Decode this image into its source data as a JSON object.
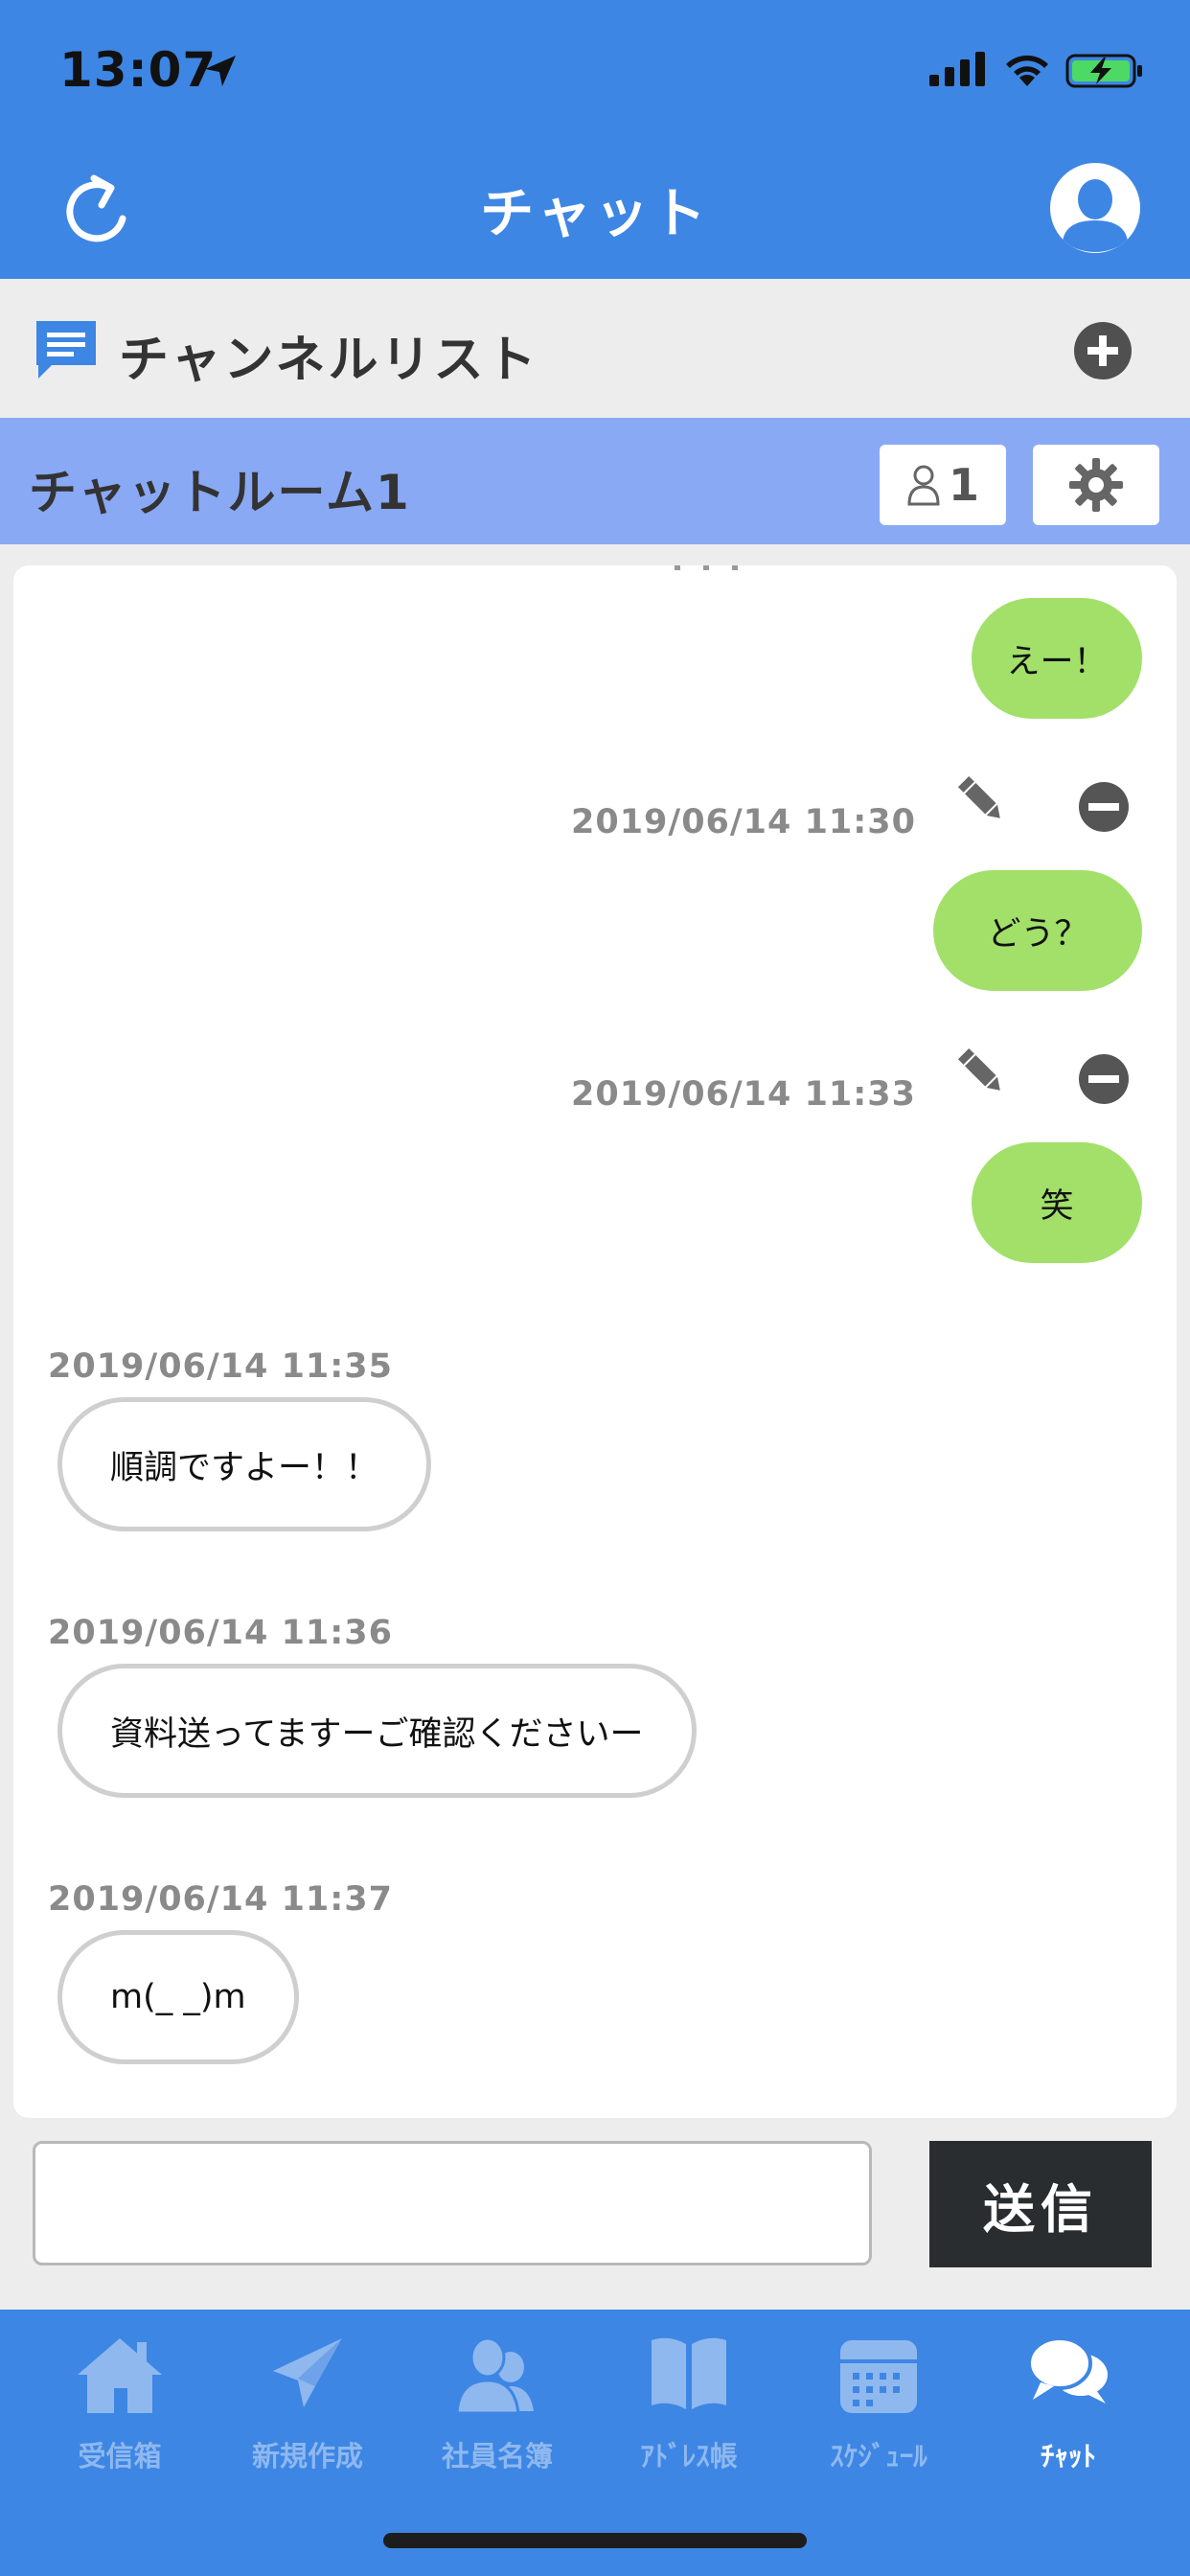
{
  "status": {
    "time": "13:07"
  },
  "nav": {
    "title": "チャット"
  },
  "channel": {
    "label": "チャンネルリスト"
  },
  "room": {
    "name": "チャットルーム1",
    "member_count": "1"
  },
  "messages": {
    "out1": {
      "text": "えー！"
    },
    "out2": {
      "time": "2019/06/14 11:30",
      "text": "どう？"
    },
    "out3": {
      "time": "2019/06/14 11:33",
      "text": "笑"
    },
    "in1": {
      "time": "2019/06/14 11:35",
      "text": "順調ですよー！！"
    },
    "in2": {
      "time": "2019/06/14 11:36",
      "text": "資料送ってますーご確認くださいー"
    },
    "in3": {
      "time": "2019/06/14 11:37",
      "text": "m(_ _)m"
    }
  },
  "composer": {
    "value": "",
    "send_label": "送信"
  },
  "tabs": [
    {
      "label": "受信箱",
      "icon": "home-icon"
    },
    {
      "label": "新規作成",
      "icon": "paper-plane-icon"
    },
    {
      "label": "社員名簿",
      "icon": "people-icon"
    },
    {
      "label": "ｱﾄﾞﾚｽ帳",
      "icon": "book-icon"
    },
    {
      "label": "ｽｹｼﾞｭｰﾙ",
      "icon": "calendar-icon"
    },
    {
      "label": "ﾁｬｯﾄ",
      "icon": "chat-bubbles-icon"
    }
  ],
  "colors": {
    "primary": "#3d86e4",
    "room_bar": "#89a9f5",
    "outgoing_bubble": "#a2e06a",
    "send_button": "#2a2d30"
  }
}
